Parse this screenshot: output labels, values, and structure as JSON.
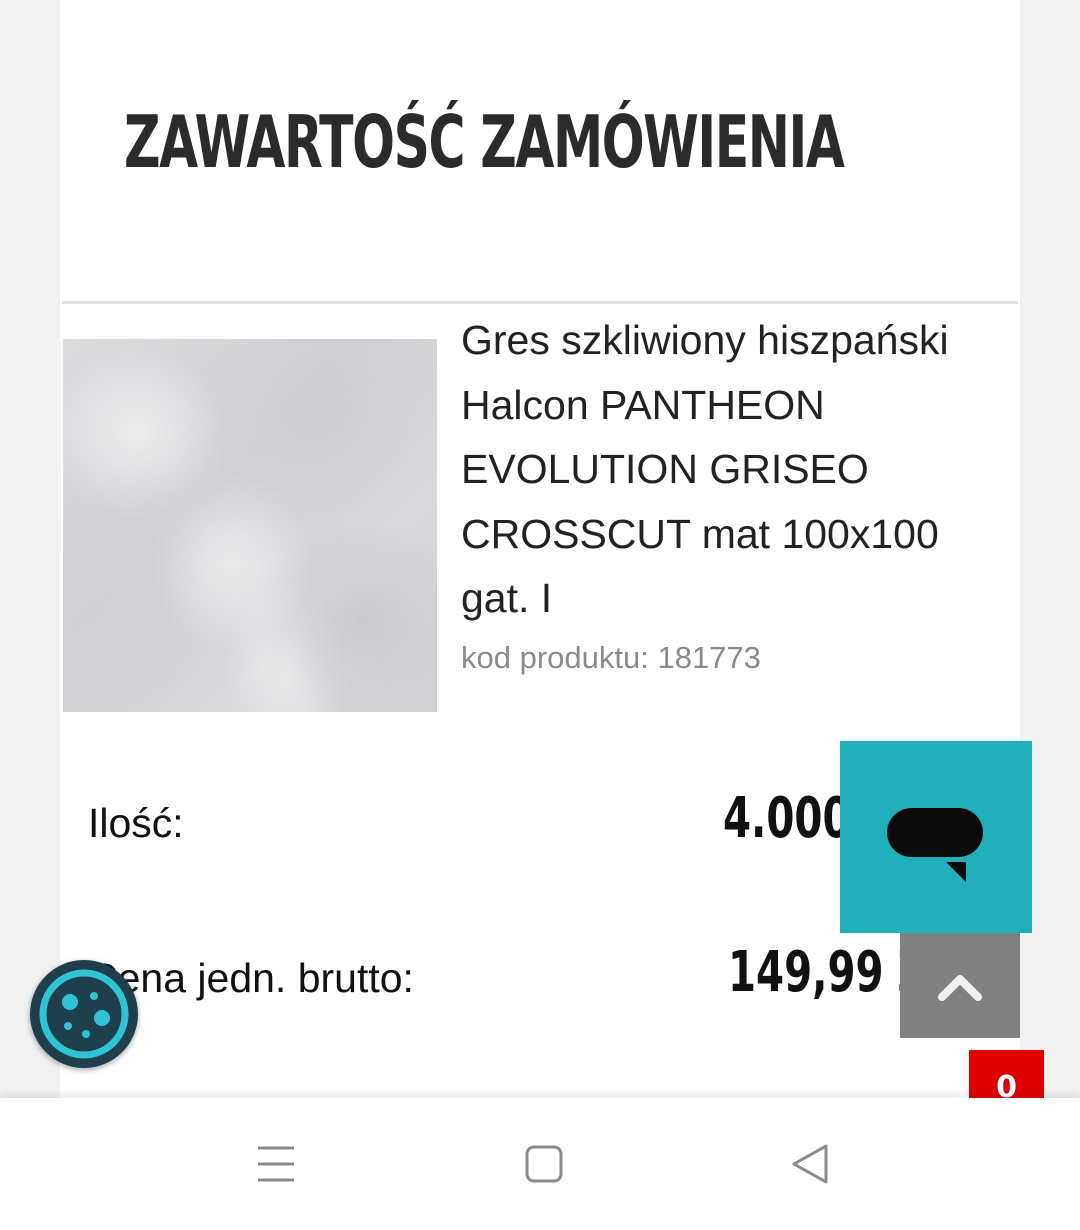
{
  "page": {
    "title": "ZAWARTOŚĆ ZAMÓWIENIA"
  },
  "product": {
    "name": "Gres szkliwiony hiszpański Halcon PANTHEON EVOLUTION GRISEO CROSSCUT mat 100x100 gat. I",
    "code_label": "kod produktu: 181773"
  },
  "order": {
    "quantity_label": "Ilość:",
    "quantity_value": "4.000",
    "price_label": "Cena jedn. brutto:",
    "price_value": "149,99 ZŁ"
  },
  "cart": {
    "count": "0"
  },
  "colors": {
    "chat_accent": "#21afbb",
    "cart_badge": "#e00000",
    "scroll_top": "#808080",
    "cookie_bg": "#1e3f4b",
    "cookie_accent": "#2ec4d6"
  },
  "icons": {
    "chat": "chat-bubble-icon",
    "scroll_top": "chevron-up-icon",
    "cookie": "cookie-icon",
    "nav_menu": "menu-icon",
    "nav_home": "home-square-icon",
    "nav_back": "back-triangle-icon"
  }
}
